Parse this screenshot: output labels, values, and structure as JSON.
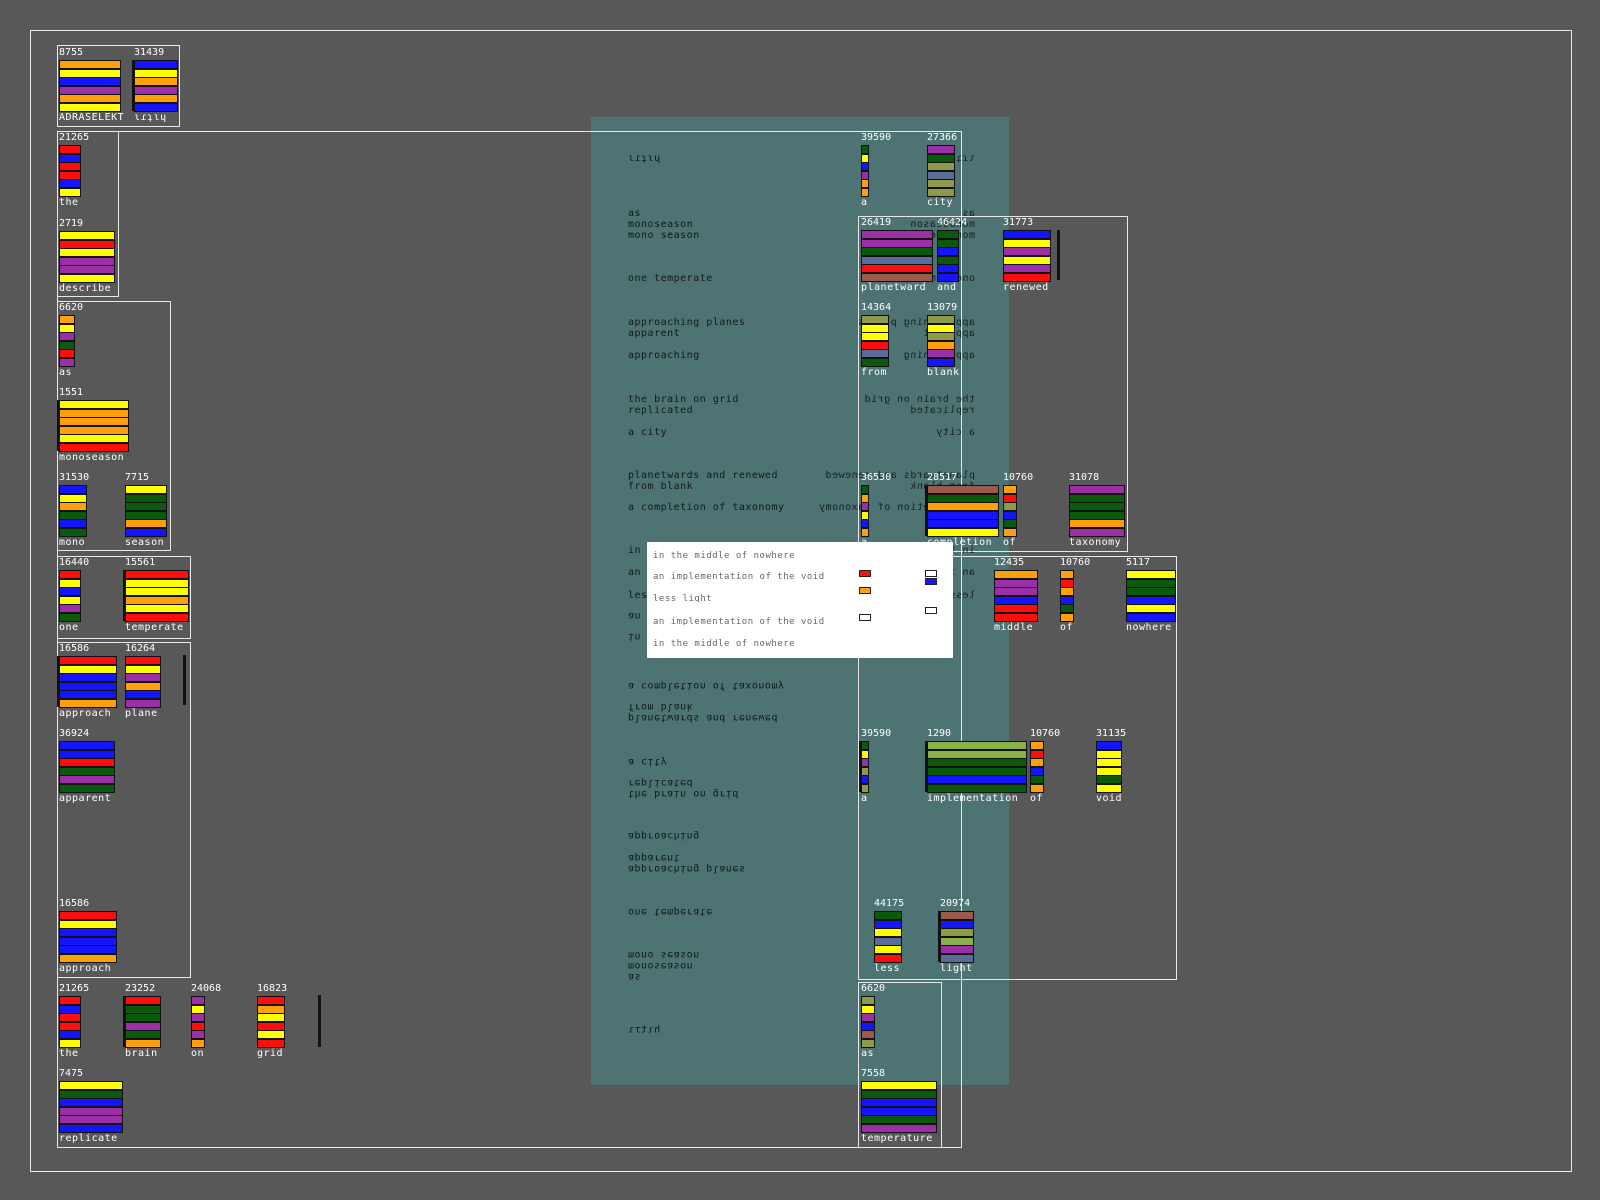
{
  "title": "ADRASELEKT",
  "palette": {
    "orange": "#ff9f0a",
    "yellow": "#ffff00",
    "blue": "#1414ff",
    "purple": "#9c2fa8",
    "red": "#ff0d0d",
    "green": "#0b5a0b",
    "olive": "#8c9a4a",
    "steel": "#5a6a9a",
    "brown": "#9c5a4a",
    "lime": "#8ab04a",
    "teal_panel": "#4e7373"
  },
  "groups": [
    {
      "label": "ADRASELEKT",
      "value": "8755",
      "colors": [
        "orange",
        "yellow",
        "blue",
        "purple",
        "orange",
        "yellow"
      ]
    },
    {
      "label": "ɩɾʇɩɥ",
      "value": "31439",
      "colors": [
        "blue",
        "yellow",
        "orange",
        "purple",
        "orange",
        "blue"
      ]
    },
    {
      "label": "the",
      "value": "21265",
      "colors": [
        "red",
        "blue",
        "red",
        "red",
        "blue",
        "yellow"
      ]
    },
    {
      "label": "describe",
      "value": "2719",
      "colors": [
        "yellow",
        "red",
        "yellow",
        "purple",
        "purple",
        "yellow"
      ]
    },
    {
      "label": "as",
      "value": "6620",
      "colors": [
        "orange",
        "yellow",
        "purple",
        "green",
        "red",
        "purple"
      ]
    },
    {
      "label": "monoseason",
      "value": "1551",
      "colors": [
        "yellow",
        "orange",
        "orange",
        "orange",
        "yellow",
        "red"
      ]
    },
    {
      "label": "mono",
      "value": "31530",
      "colors": [
        "blue",
        "yellow",
        "orange",
        "green",
        "blue",
        "green"
      ]
    },
    {
      "label": "season",
      "value": "7715",
      "colors": [
        "yellow",
        "green",
        "green",
        "green",
        "orange",
        "blue"
      ]
    },
    {
      "label": "one",
      "value": "16440",
      "colors": [
        "red",
        "yellow",
        "blue",
        "yellow",
        "purple",
        "green"
      ]
    },
    {
      "label": "temperate",
      "value": "15561",
      "colors": [
        "red",
        "yellow",
        "yellow",
        "orange",
        "yellow",
        "red"
      ]
    },
    {
      "label": "approach",
      "value": "16586",
      "colors": [
        "red",
        "yellow",
        "blue",
        "blue",
        "blue",
        "orange"
      ]
    },
    {
      "label": "plane",
      "value": "16264",
      "colors": [
        "red",
        "yellow",
        "purple",
        "orange",
        "blue",
        "purple"
      ]
    },
    {
      "label": "apparent",
      "value": "36924",
      "colors": [
        "blue",
        "blue",
        "red",
        "green",
        "purple",
        "green"
      ]
    },
    {
      "label": "approach",
      "value": "16586",
      "colors": [
        "red",
        "yellow",
        "blue",
        "blue",
        "blue",
        "orange"
      ]
    },
    {
      "label": "the",
      "value": "21265",
      "colors": [
        "red",
        "blue",
        "red",
        "red",
        "blue",
        "yellow"
      ]
    },
    {
      "label": "brain",
      "value": "23252",
      "colors": [
        "red",
        "green",
        "green",
        "purple",
        "green",
        "orange"
      ]
    },
    {
      "label": "on",
      "value": "24068",
      "colors": [
        "purple",
        "yellow",
        "purple",
        "red",
        "purple",
        "orange"
      ]
    },
    {
      "label": "grid",
      "value": "16823",
      "colors": [
        "red",
        "orange",
        "yellow",
        "red",
        "yellow",
        "red"
      ]
    },
    {
      "label": "replicate",
      "value": "7475",
      "colors": [
        "yellow",
        "green",
        "blue",
        "purple",
        "purple",
        "blue"
      ]
    },
    {
      "label": "a",
      "value": "39590",
      "colors": [
        "green",
        "yellow",
        "blue",
        "purple",
        "orange",
        "orange"
      ]
    },
    {
      "label": "city",
      "value": "27366",
      "colors": [
        "purple",
        "green",
        "olive",
        "steel",
        "olive",
        "olive"
      ]
    },
    {
      "label": "planetward",
      "value": "26419",
      "colors": [
        "purple",
        "purple",
        "green",
        "steel",
        "red",
        "brown"
      ]
    },
    {
      "label": "and",
      "value": "46424",
      "colors": [
        "green",
        "green",
        "blue",
        "green",
        "blue",
        "blue"
      ]
    },
    {
      "label": "renewed",
      "value": "31773",
      "colors": [
        "blue",
        "yellow",
        "purple",
        "yellow",
        "purple",
        "red"
      ]
    },
    {
      "label": "from",
      "value": "14364",
      "colors": [
        "olive",
        "yellow",
        "yellow",
        "red",
        "steel",
        "green"
      ]
    },
    {
      "label": "blank",
      "value": "13079",
      "colors": [
        "olive",
        "yellow",
        "olive",
        "orange",
        "purple",
        "blue"
      ]
    },
    {
      "label": "a",
      "value": "36530",
      "colors": [
        "green",
        "orange",
        "purple",
        "yellow",
        "blue",
        "orange"
      ]
    },
    {
      "label": "completion",
      "value": "28517",
      "colors": [
        "brown",
        "green",
        "orange",
        "blue",
        "blue",
        "yellow"
      ]
    },
    {
      "label": "of",
      "value": "10760",
      "colors": [
        "orange",
        "red",
        "olive",
        "blue",
        "green",
        "orange"
      ]
    },
    {
      "label": "taxonomy",
      "value": "31078",
      "colors": [
        "purple",
        "green",
        "green",
        "green",
        "orange",
        "purple"
      ]
    },
    {
      "label": "middle",
      "value": "12435",
      "colors": [
        "orange",
        "purple",
        "purple",
        "blue",
        "red",
        "red"
      ]
    },
    {
      "label": "of",
      "value": "10760",
      "colors": [
        "orange",
        "red",
        "orange",
        "blue",
        "green",
        "orange"
      ]
    },
    {
      "label": "nowhere",
      "value": "5117",
      "colors": [
        "yellow",
        "green",
        "green",
        "blue",
        "yellow",
        "blue"
      ]
    },
    {
      "label": "a",
      "value": "39590",
      "colors": [
        "green",
        "yellow",
        "purple",
        "olive",
        "blue",
        "olive"
      ]
    },
    {
      "label": "implementation",
      "value": "1290",
      "colors": [
        "lime",
        "lime",
        "green",
        "green",
        "blue",
        "green"
      ]
    },
    {
      "label": "of",
      "value": "10760",
      "colors": [
        "orange",
        "red",
        "orange",
        "blue",
        "green",
        "orange"
      ]
    },
    {
      "label": "void",
      "value": "31135",
      "colors": [
        "blue",
        "yellow",
        "yellow",
        "yellow",
        "green",
        "yellow"
      ]
    },
    {
      "label": "less",
      "value": "44175",
      "colors": [
        "green",
        "blue",
        "yellow",
        "steel",
        "yellow",
        "red"
      ]
    },
    {
      "label": "light",
      "value": "20974",
      "colors": [
        "brown",
        "blue",
        "olive",
        "lime",
        "purple",
        "steel"
      ]
    },
    {
      "label": "as",
      "value": "6620",
      "colors": [
        "olive",
        "yellow",
        "purple",
        "blue",
        "brown",
        "olive"
      ]
    },
    {
      "label": "temperature",
      "value": "7558",
      "colors": [
        "yellow",
        "green",
        "blue",
        "blue",
        "green",
        "purple"
      ]
    }
  ],
  "poem_lines": [
    "ɩɾʇɩɥ",
    "as",
    "monoseason",
    "mono season",
    "one temperate",
    "approaching planes",
    "apparent",
    "approaching",
    "the brain on grid",
    "replicated",
    "a city",
    "planetwards and renewed",
    "from blank",
    "a completion of taxonomy",
    "in the middle of nowhere",
    "an implementation of the void",
    "less light",
    "an implementation of the void",
    "in the middle of nowhere",
    "a completion of taxonomy",
    "from blank",
    "planetwards and renewed",
    "a city",
    "replicated",
    "the brain on grid",
    "approaching",
    "apparent",
    "approaching planes",
    "one temperate",
    "mono season",
    "monoseason",
    "as",
    "ɩɾʇɩɥ"
  ],
  "poem_right_lines": [
    "ɩɾʇɩɥ",
    "as",
    "monoseason",
    "mono season",
    "one temperate",
    "approaching planes",
    "apparent",
    "approaching",
    "the brain on grid",
    "replicated",
    "a city",
    "planetwards and renewed",
    "from blank",
    "a completion of taxonomy",
    "in the middle of nowhere",
    "an implementation of the void",
    "less light"
  ]
}
